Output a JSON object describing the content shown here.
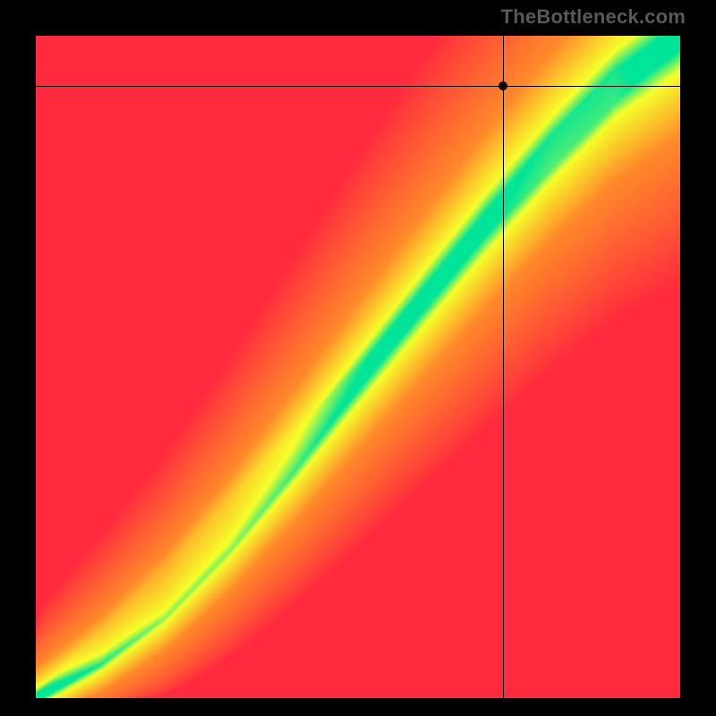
{
  "watermark": "TheBottleneck.com",
  "chart_data": {
    "type": "heatmap",
    "title": "",
    "xlabel": "",
    "ylabel": "",
    "xlim": [
      0,
      1
    ],
    "ylim": [
      0,
      1
    ],
    "color_scale": {
      "low": "#ff2a3e",
      "mid_low": "#ff8a2a",
      "mid": "#f6ff2a",
      "optimal": "#00e598",
      "description": "red=bottleneck, green=balanced"
    },
    "optimal_curve": {
      "description": "diagonal ridge of balanced CPU/GPU, concave-up",
      "points": [
        [
          0.0,
          0.0
        ],
        [
          0.1,
          0.05
        ],
        [
          0.2,
          0.12
        ],
        [
          0.3,
          0.22
        ],
        [
          0.4,
          0.34
        ],
        [
          0.5,
          0.47
        ],
        [
          0.6,
          0.6
        ],
        [
          0.7,
          0.73
        ],
        [
          0.8,
          0.85
        ],
        [
          0.9,
          0.95
        ],
        [
          1.0,
          1.0
        ]
      ]
    },
    "marker": {
      "x": 0.725,
      "y": 0.925,
      "label": ""
    }
  }
}
